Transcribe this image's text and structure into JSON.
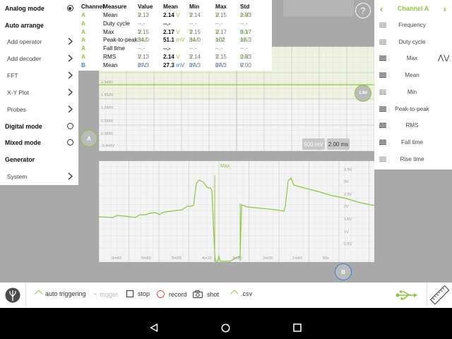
{
  "left_menu": {
    "items": [
      {
        "label": "Analog mode",
        "style": "bold",
        "control": "radio-on"
      },
      {
        "label": "Auto arrange",
        "style": "bold",
        "control": "none"
      },
      {
        "label": "Add operator",
        "style": "sub",
        "control": "chevron"
      },
      {
        "label": "Add decoder",
        "style": "sub",
        "control": "chevron"
      },
      {
        "label": "FFT",
        "style": "sub",
        "control": "chevron"
      },
      {
        "label": "X-Y Plot",
        "style": "sub",
        "control": "chevron"
      },
      {
        "label": "Probes",
        "style": "sub",
        "control": "chevron"
      },
      {
        "label": "Digital mode",
        "style": "bold",
        "control": "radio-off"
      },
      {
        "label": "Mixed mode",
        "style": "bold",
        "control": "radio-off"
      },
      {
        "label": "Generator",
        "style": "bold",
        "control": "none"
      },
      {
        "label": "System",
        "style": "sub",
        "control": "chevron"
      }
    ]
  },
  "measurements": {
    "headers": [
      "Channel",
      "Measure",
      "Value",
      "Mean",
      "Min",
      "Max",
      "Std"
    ],
    "rows": [
      {
        "channel": "A",
        "measure": "Mean",
        "value": "2.13",
        "value_unit": "V",
        "mean": "2.14",
        "mean_unit": "V",
        "min": "2.14",
        "min_unit": "V",
        "max": "2.15",
        "max_unit": "V",
        "std": "2.83",
        "std_unit": "mV"
      },
      {
        "channel": "A",
        "measure": "Duty cycle",
        "value": "--.-",
        "value_unit": "",
        "mean": "--.-",
        "mean_unit": "",
        "min": "--.-",
        "min_unit": "",
        "max": "--.-",
        "max_unit": "",
        "std": "--.-",
        "std_unit": ""
      },
      {
        "channel": "A",
        "measure": "Max",
        "value": "2.15",
        "value_unit": "V",
        "mean": "2.17",
        "mean_unit": "V",
        "min": "2.15",
        "min_unit": "V",
        "max": "2.17",
        "max_unit": "V",
        "std": "9.17",
        "std_unit": "mV"
      },
      {
        "channel": "A",
        "measure": "Peak-to-peak",
        "value": "34.0",
        "value_unit": "mV",
        "mean": "51.1",
        "mean_unit": "mV",
        "min": "34.0",
        "min_unit": "mV",
        "max": "102",
        "max_unit": "mV",
        "std": "18.3",
        "std_unit": "mV"
      },
      {
        "channel": "A",
        "measure": "Fall time",
        "value": "--.-",
        "value_unit": "",
        "mean": "--.-",
        "mean_unit": "",
        "min": "--.-",
        "min_unit": "",
        "max": "--.-",
        "max_unit": "",
        "std": "--.-",
        "std_unit": ""
      },
      {
        "channel": "A",
        "measure": "RMS",
        "value": "2.13",
        "value_unit": "V",
        "mean": "2.14",
        "mean_unit": "V",
        "min": "2.14",
        "min_unit": "V",
        "max": "2.15",
        "max_unit": "V",
        "std": "2.83",
        "std_unit": "mV"
      },
      {
        "channel": "B",
        "measure": "Mean",
        "value": "27.3",
        "value_unit": "mV",
        "mean": "27.3",
        "mean_unit": "mV",
        "min": "27.3",
        "min_unit": "mV",
        "max": "27.3",
        "max_unit": "mV",
        "std": "0.00",
        "std_unit": "V"
      }
    ]
  },
  "upper_plot": {
    "y_ticks": [
      "2.548V",
      "1.552V",
      "1.048V",
      "0.556V",
      "0.058V",
      "-0.444V"
    ],
    "volts_per_div": "500 mV",
    "time_per_div": "2.00 ms",
    "channel_a_marker": "A",
    "right_marker": "1.84"
  },
  "lower_plot": {
    "label": "Max",
    "y_ticks": [
      "3.5V",
      "3V",
      "2.5V",
      "2V",
      "1.5V",
      "1V",
      "0.5V"
    ],
    "x_ticks": [
      "6m40",
      "5m60",
      "5m00",
      "4m18",
      "3m20",
      "2m30",
      "1m40",
      "50s"
    ],
    "channel_b_marker": "B"
  },
  "help_button": "?",
  "right_panel": {
    "title": "Channel A",
    "items": [
      {
        "label": "Frequency",
        "active": false
      },
      {
        "label": "Duty cycle",
        "active": false
      },
      {
        "label": "Max",
        "active": true
      },
      {
        "label": "Mean",
        "active": true
      },
      {
        "label": "Min",
        "active": false
      },
      {
        "label": "Peak-to-peak",
        "active": true
      },
      {
        "label": "RMS",
        "active": true
      },
      {
        "label": "Fall time",
        "active": true
      },
      {
        "label": "Rise time",
        "active": false
      }
    ]
  },
  "toolbar": {
    "auto_triggering": "auto triggering",
    "trigger": "trigger",
    "stop": "stop",
    "record": "record",
    "shot": "shot",
    "csv": ".csv"
  },
  "colors": {
    "channel_a": "#8cc63f",
    "channel_b": "#3b7fd9",
    "record": "#e44444"
  },
  "icons": {
    "app_logo": "tree-logo-icon",
    "usb": "usb-icon",
    "ruler": "ruler-icon",
    "back": "android-back-icon",
    "home": "android-home-icon",
    "recents": "android-recents-icon"
  }
}
